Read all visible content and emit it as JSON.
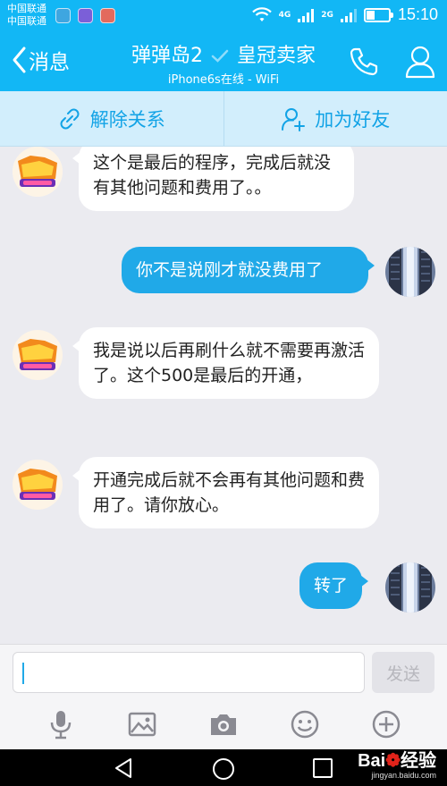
{
  "status_bar": {
    "carrier_1": "中国联通",
    "carrier_2": "中国联通",
    "net_1": "4G",
    "net_2": "2G",
    "time": "15:10"
  },
  "header": {
    "back_label": "消息",
    "title": "弹弹岛2",
    "title_suffix": "皇冠卖家",
    "subtitle": "iPhone6s在线 - WiFi"
  },
  "actions": {
    "unbind_label": "解除关系",
    "add_friend_label": "加为好友"
  },
  "messages": [
    {
      "side": "in",
      "text": "这个是最后的程序，完成后就没有其他问题和费用了。。"
    },
    {
      "side": "out",
      "text": "你不是说刚才就没费用了"
    },
    {
      "side": "in",
      "text": "我是说以后再刷什么就不需要再激活了。这个500是最后的开通，"
    },
    {
      "side": "in",
      "text": "开通完成后就不会再有其他问题和费用了。请你放心。"
    },
    {
      "side": "out",
      "text": "转了"
    }
  ],
  "composer": {
    "value": "",
    "send_label": "发送"
  },
  "toolbar_icons": [
    "microphone-icon",
    "image-icon",
    "camera-icon",
    "emoji-icon",
    "plus-icon"
  ],
  "watermark": {
    "brand": "Bai",
    "brand_suffix": "经验",
    "sub": "jingyan.baidu.com"
  },
  "colors": {
    "accent": "#12b7f5",
    "outgoing_bubble": "#20a9e8",
    "action_bar": "#d2eefc",
    "background": "#ebebf0"
  }
}
